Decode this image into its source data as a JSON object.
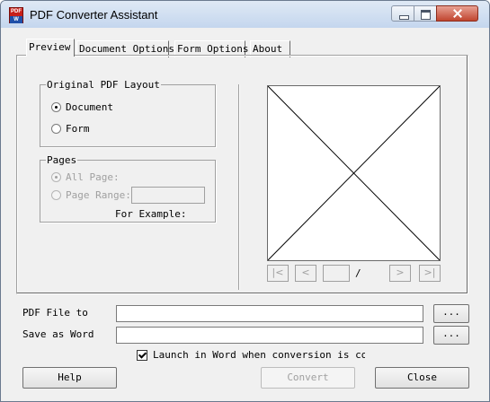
{
  "window": {
    "title": "PDF Converter Assistant",
    "icon_text_top": "PDF",
    "icon_text_bottom": "W"
  },
  "tabs": [
    "Preview",
    "Document Options",
    "Form Options",
    "About"
  ],
  "layout_group": {
    "legend": "Original PDF Layout",
    "options": [
      {
        "label": "Document",
        "selected": true
      },
      {
        "label": "Form",
        "selected": false
      }
    ]
  },
  "pages_group": {
    "legend": "Pages",
    "options": [
      {
        "label": "All Page:",
        "selected": true,
        "enabled": false
      },
      {
        "label": "Page Range:",
        "selected": false,
        "enabled": false
      }
    ],
    "range_value": "",
    "example_label": "For Example:"
  },
  "preview": {
    "nav": {
      "first": "|<",
      "prev": "<",
      "next": ">",
      "last": ">|"
    },
    "page_value": "",
    "page_separator": "/"
  },
  "file_to": {
    "label": "PDF File to",
    "value": "",
    "browse": "..."
  },
  "save_as": {
    "label": "Save as Word",
    "value": "",
    "browse": "..."
  },
  "launch_word": {
    "label": "Launch in Word when conversion is comple",
    "checked": true
  },
  "buttons": {
    "help": "Help",
    "convert": "Convert",
    "close": "Close"
  }
}
